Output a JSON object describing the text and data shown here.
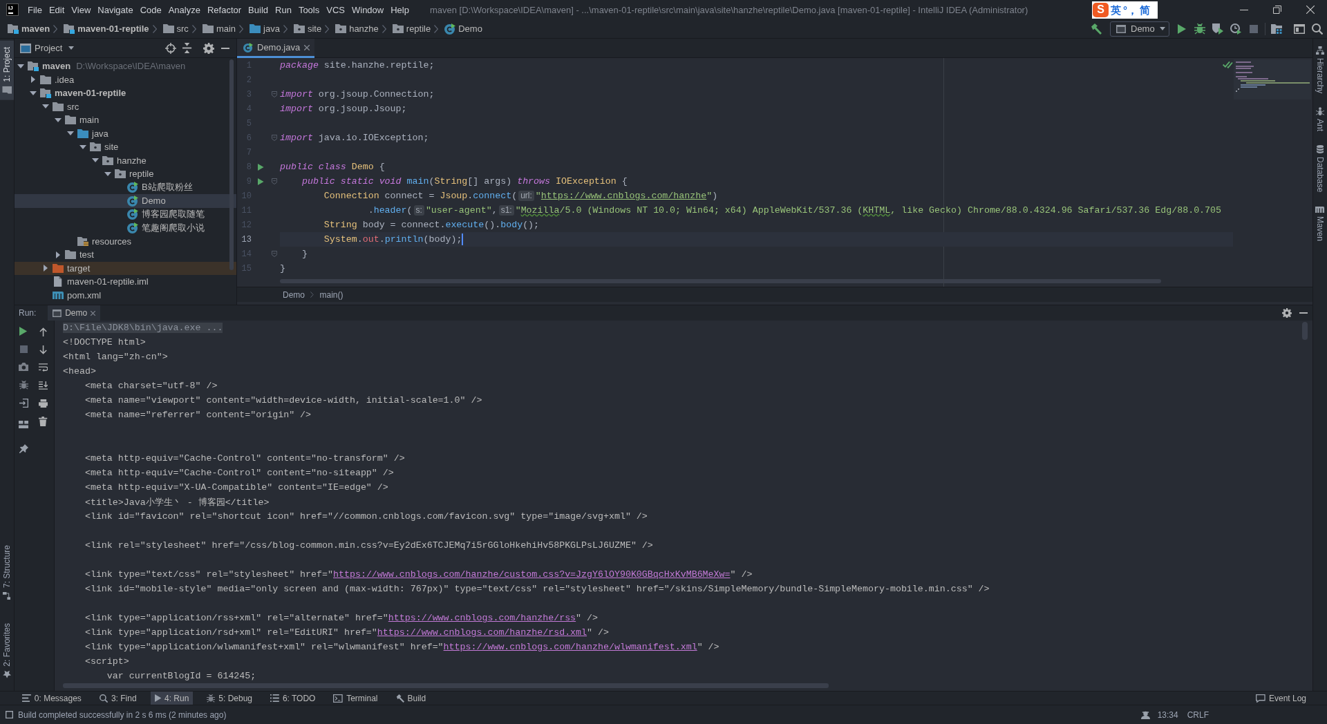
{
  "window": {
    "logo": "IJ",
    "title": "maven [D:\\Workspace\\IDEA\\maven] - ...\\maven-01-reptile\\src\\main\\java\\site\\hanzhe\\reptile\\Demo.java [maven-01-reptile] - IntelliJ IDEA (Administrator)"
  },
  "menu": [
    "File",
    "Edit",
    "View",
    "Navigate",
    "Code",
    "Analyze",
    "Refactor",
    "Build",
    "Run",
    "Tools",
    "VCS",
    "Window",
    "Help"
  ],
  "input_method_bar": {
    "logo": "S",
    "items": [
      "英",
      "°，",
      "简"
    ]
  },
  "navigation_bar": {
    "crumbs": [
      {
        "label": "maven",
        "kind": "module"
      },
      {
        "label": "maven-01-reptile",
        "kind": "module"
      },
      {
        "label": "src",
        "kind": "folder"
      },
      {
        "label": "main",
        "kind": "folder"
      },
      {
        "label": "java",
        "kind": "source"
      },
      {
        "label": "site",
        "kind": "package"
      },
      {
        "label": "hanzhe",
        "kind": "package"
      },
      {
        "label": "reptile",
        "kind": "package"
      },
      {
        "label": "Demo",
        "kind": "class"
      }
    ],
    "run_configuration": "Demo"
  },
  "left_stripe": {
    "top": [
      {
        "label": "1: Project",
        "kind": "project",
        "selected": true
      }
    ],
    "bottom": [
      {
        "label": "7: Structure",
        "kind": "structure",
        "selected": false
      },
      {
        "label": "2: Favorites",
        "kind": "favorites",
        "selected": false
      }
    ]
  },
  "right_stripe": [
    {
      "label": "Hierarchy",
      "kind": "hierarchy"
    },
    {
      "label": "Ant",
      "kind": "ant"
    },
    {
      "label": "Database",
      "kind": "database"
    },
    {
      "label": "Maven",
      "kind": "maven"
    }
  ],
  "project": {
    "view": "Project",
    "tree": [
      {
        "label": "maven",
        "kind": "module",
        "path": "D:\\Workspace\\IDEA\\maven",
        "expanded": true,
        "selected": false,
        "children": [
          {
            "label": ".idea",
            "kind": "folder",
            "expanded": false,
            "selected": false
          },
          {
            "label": "maven-01-reptile",
            "kind": "module",
            "expanded": true,
            "selected": false,
            "children": [
              {
                "label": "src",
                "kind": "folder",
                "expanded": true,
                "selected": false,
                "children": [
                  {
                    "label": "main",
                    "kind": "folder",
                    "expanded": true,
                    "selected": false,
                    "children": [
                      {
                        "label": "java",
                        "kind": "source",
                        "expanded": true,
                        "selected": false,
                        "children": [
                          {
                            "label": "site",
                            "kind": "package",
                            "expanded": true,
                            "selected": false,
                            "children": [
                              {
                                "label": "hanzhe",
                                "kind": "package",
                                "expanded": true,
                                "selected": false,
                                "children": [
                                  {
                                    "label": "reptile",
                                    "kind": "package",
                                    "expanded": true,
                                    "selected": false,
                                    "children": [
                                      {
                                        "label": "B站爬取粉丝",
                                        "kind": "class",
                                        "selected": false
                                      },
                                      {
                                        "label": "Demo",
                                        "kind": "class",
                                        "selected": true
                                      },
                                      {
                                        "label": "博客园爬取随笔",
                                        "kind": "class",
                                        "selected": false
                                      },
                                      {
                                        "label": "笔趣阁爬取小说",
                                        "kind": "class",
                                        "selected": false
                                      }
                                    ]
                                  }
                                ]
                              }
                            ]
                          }
                        ]
                      },
                      {
                        "label": "resources",
                        "kind": "resources",
                        "selected": false
                      }
                    ]
                  },
                  {
                    "label": "test",
                    "kind": "folder",
                    "expanded": false,
                    "selected": false
                  }
                ]
              },
              {
                "label": "target",
                "kind": "excluded",
                "expanded": false,
                "selected": false
              },
              {
                "label": "maven-01-reptile.iml",
                "kind": "iml",
                "selected": false
              },
              {
                "label": "pom.xml",
                "kind": "maven",
                "selected": false
              }
            ]
          }
        ]
      }
    ]
  },
  "editor": {
    "tabs": [
      {
        "label": "Demo.java",
        "selected": true
      }
    ],
    "lines": [
      {
        "number": "1",
        "current": false,
        "run_marker": false,
        "fold": false,
        "tokens": [
          {
            "text": "package",
            "kind": "keyword"
          },
          {
            "text": " site.hanzhe.reptile;",
            "kind": "plain"
          }
        ]
      },
      {
        "number": "2",
        "current": false,
        "run_marker": false,
        "fold": false
      },
      {
        "number": "3",
        "current": false,
        "run_marker": false,
        "fold": true,
        "tokens": [
          {
            "text": "import",
            "kind": "keyword"
          },
          {
            "text": " org.jsoup.Connection;",
            "kind": "plain"
          }
        ]
      },
      {
        "number": "4",
        "current": false,
        "run_marker": false,
        "fold": false,
        "tokens": [
          {
            "text": "import",
            "kind": "keyword"
          },
          {
            "text": " org.jsoup.Jsoup;",
            "kind": "plain"
          }
        ]
      },
      {
        "number": "5",
        "current": false,
        "run_marker": false,
        "fold": false
      },
      {
        "number": "6",
        "current": false,
        "run_marker": false,
        "fold": true,
        "tokens": [
          {
            "text": "import",
            "kind": "keyword"
          },
          {
            "text": " java.io.IOException;",
            "kind": "plain"
          }
        ]
      },
      {
        "number": "7",
        "current": false,
        "run_marker": false,
        "fold": false
      },
      {
        "number": "8",
        "current": false,
        "run_marker": true,
        "fold": false,
        "tokens": [
          {
            "text": "public class ",
            "kind": "keyword"
          },
          {
            "text": "Demo",
            "kind": "type"
          },
          {
            "text": " {",
            "kind": "plain"
          }
        ]
      },
      {
        "number": "9",
        "current": false,
        "run_marker": true,
        "fold": true,
        "tokens": [
          {
            "text": "    public static void ",
            "kind": "keyword"
          },
          {
            "text": "main",
            "kind": "method"
          },
          {
            "text": "(",
            "kind": "plain"
          },
          {
            "text": "String",
            "kind": "type"
          },
          {
            "text": "[] args) ",
            "kind": "plain"
          },
          {
            "text": "throws ",
            "kind": "keyword"
          },
          {
            "text": "IOException",
            "kind": "type"
          },
          {
            "text": " {",
            "kind": "plain"
          }
        ]
      },
      {
        "number": "10",
        "current": false,
        "run_marker": false,
        "fold": false,
        "tokens": [
          {
            "text": "        Connection",
            "kind": "type"
          },
          {
            "text": " connect = ",
            "kind": "plain"
          },
          {
            "text": "Jsoup",
            "kind": "type"
          },
          {
            "text": ".",
            "kind": "plain"
          },
          {
            "text": "connect",
            "kind": "method"
          },
          {
            "text": "(",
            "kind": "plain"
          },
          {
            "text": "url:",
            "kind": "hint"
          },
          {
            "text": "\"",
            "kind": "string"
          },
          {
            "text": "https://www.cnblogs.com/hanzhe",
            "kind": "url"
          },
          {
            "text": "\"",
            "kind": "string"
          },
          {
            "text": ")",
            "kind": "plain"
          }
        ]
      },
      {
        "number": "11",
        "current": false,
        "run_marker": false,
        "fold": false,
        "tokens": [
          {
            "text": "                .",
            "kind": "plain"
          },
          {
            "text": "header",
            "kind": "method"
          },
          {
            "text": "(",
            "kind": "plain"
          },
          {
            "text": "s:",
            "kind": "hint"
          },
          {
            "text": "\"user-agent\"",
            "kind": "string"
          },
          {
            "text": ",",
            "kind": "plain"
          },
          {
            "text": "s1:",
            "kind": "hint"
          },
          {
            "text": "\"",
            "kind": "string"
          },
          {
            "text": "Mozilla",
            "kind": "typo"
          },
          {
            "text": "/5.0 (Windows NT 10.0; Win64; x64) AppleWebKit/537.36 (",
            "kind": "string"
          },
          {
            "text": "KHTML",
            "kind": "typo"
          },
          {
            "text": ", like Gecko) Chrome/88.0.4324.96 Safari/537.36 Edg/88.0.705",
            "kind": "string"
          }
        ]
      },
      {
        "number": "12",
        "current": false,
        "run_marker": false,
        "fold": false,
        "tokens": [
          {
            "text": "        String",
            "kind": "type"
          },
          {
            "text": " body = connect.",
            "kind": "plain"
          },
          {
            "text": "execute",
            "kind": "method"
          },
          {
            "text": "().",
            "kind": "plain"
          },
          {
            "text": "body",
            "kind": "method"
          },
          {
            "text": "();",
            "kind": "plain"
          }
        ]
      },
      {
        "number": "13",
        "current": true,
        "run_marker": false,
        "fold": false,
        "tokens": [
          {
            "text": "        System",
            "kind": "type"
          },
          {
            "text": ".",
            "kind": "plain"
          },
          {
            "text": "out",
            "kind": "field"
          },
          {
            "text": ".",
            "kind": "plain"
          },
          {
            "text": "println",
            "kind": "method"
          },
          {
            "text": "(body);",
            "kind": "plain"
          }
        ]
      },
      {
        "number": "14",
        "current": false,
        "run_marker": false,
        "fold": true,
        "tokens": [
          {
            "text": "    }",
            "kind": "plain"
          }
        ]
      },
      {
        "number": "15",
        "current": false,
        "run_marker": false,
        "fold": false,
        "tokens": [
          {
            "text": "}",
            "kind": "plain"
          }
        ]
      }
    ],
    "breadcrumbs": [
      "Demo",
      "main()"
    ]
  },
  "run": {
    "label": "Run:",
    "tabs": [
      {
        "label": "Demo",
        "selected": true
      }
    ],
    "console": [
      {
        "kind": "command",
        "parts": [
          {
            "text": "D:\\File\\JDK8\\bin\\java.exe ...",
            "kind": "text"
          }
        ]
      },
      {
        "kind": "output",
        "parts": [
          {
            "text": "<!DOCTYPE html>",
            "kind": "text"
          }
        ]
      },
      {
        "kind": "output",
        "parts": [
          {
            "text": "<html lang=\"zh-cn\">",
            "kind": "text"
          }
        ]
      },
      {
        "kind": "output",
        "parts": [
          {
            "text": "<head>",
            "kind": "text"
          }
        ]
      },
      {
        "kind": "output",
        "parts": [
          {
            "text": "    <meta charset=\"utf-8\" />",
            "kind": "text"
          }
        ]
      },
      {
        "kind": "output",
        "parts": [
          {
            "text": "    <meta name=\"viewport\" content=\"width=device-width, initial-scale=1.0\" />",
            "kind": "text"
          }
        ]
      },
      {
        "kind": "output",
        "parts": [
          {
            "text": "    <meta name=\"referrer\" content=\"origin\" />",
            "kind": "text"
          }
        ]
      },
      {
        "kind": "blank"
      },
      {
        "kind": "blank"
      },
      {
        "kind": "output",
        "parts": [
          {
            "text": "    <meta http-equiv=\"Cache-Control\" content=\"no-transform\" />",
            "kind": "text"
          }
        ]
      },
      {
        "kind": "output",
        "parts": [
          {
            "text": "    <meta http-equiv=\"Cache-Control\" content=\"no-siteapp\" />",
            "kind": "text"
          }
        ]
      },
      {
        "kind": "output",
        "parts": [
          {
            "text": "    <meta http-equiv=\"X-UA-Compatible\" content=\"IE=edge\" />",
            "kind": "text"
          }
        ]
      },
      {
        "kind": "output",
        "parts": [
          {
            "text": "    <title>Java小学生丶 - 博客园</title>",
            "kind": "text"
          }
        ]
      },
      {
        "kind": "output",
        "parts": [
          {
            "text": "    <link id=\"favicon\" rel=\"shortcut icon\" href=\"//common.cnblogs.com/favicon.svg\" type=\"image/svg+xml\" />",
            "kind": "text"
          }
        ]
      },
      {
        "kind": "blank"
      },
      {
        "kind": "output",
        "parts": [
          {
            "text": "    <link rel=\"stylesheet\" href=\"/css/blog-common.min.css?v=Ey2dEx6TCJEMq7i5rGGloHkehiHv58PKGLPsLJ6UZME\" />",
            "kind": "text"
          }
        ]
      },
      {
        "kind": "blank"
      },
      {
        "kind": "output",
        "parts": [
          {
            "text": "    <link type=\"text/css\" rel=\"stylesheet\" href=\"",
            "kind": "text"
          },
          {
            "text": "https://www.cnblogs.com/hanzhe/custom.css?v=JzgY6lOY90K0GBqcHxKvMB6MeXw=",
            "kind": "link"
          },
          {
            "text": "\" />",
            "kind": "text"
          }
        ]
      },
      {
        "kind": "output",
        "parts": [
          {
            "text": "    <link id=\"mobile-style\" media=\"only screen and (max-width: 767px)\" type=\"text/css\" rel=\"stylesheet\" href=\"/skins/SimpleMemory/bundle-SimpleMemory-mobile.min.css\" />",
            "kind": "text"
          }
        ]
      },
      {
        "kind": "blank"
      },
      {
        "kind": "output",
        "parts": [
          {
            "text": "    <link type=\"application/rss+xml\" rel=\"alternate\" href=\"",
            "kind": "text"
          },
          {
            "text": "https://www.cnblogs.com/hanzhe/rss",
            "kind": "link"
          },
          {
            "text": "\" />",
            "kind": "text"
          }
        ]
      },
      {
        "kind": "output",
        "parts": [
          {
            "text": "    <link type=\"application/rsd+xml\" rel=\"EditURI\" href=\"",
            "kind": "text"
          },
          {
            "text": "https://www.cnblogs.com/hanzhe/rsd.xml",
            "kind": "link"
          },
          {
            "text": "\" />",
            "kind": "text"
          }
        ]
      },
      {
        "kind": "output",
        "parts": [
          {
            "text": "    <link type=\"application/wlwmanifest+xml\" rel=\"wlwmanifest\" href=\"",
            "kind": "text"
          },
          {
            "text": "https://www.cnblogs.com/hanzhe/wlwmanifest.xml",
            "kind": "link"
          },
          {
            "text": "\" />",
            "kind": "text"
          }
        ]
      },
      {
        "kind": "output",
        "parts": [
          {
            "text": "    <script>",
            "kind": "text"
          }
        ]
      },
      {
        "kind": "output",
        "parts": [
          {
            "text": "        var currentBlogId = 614245;",
            "kind": "text"
          }
        ]
      }
    ]
  },
  "tool_windows": [
    {
      "label": "0: Messages",
      "kind": "messages",
      "selected": false
    },
    {
      "label": "3: Find",
      "kind": "find",
      "selected": false
    },
    {
      "label": "4: Run",
      "kind": "run",
      "selected": true
    },
    {
      "label": "5: Debug",
      "kind": "debug",
      "selected": false
    },
    {
      "label": "6: TODO",
      "kind": "todo",
      "selected": false
    },
    {
      "label": "Terminal",
      "kind": "terminal",
      "selected": false
    },
    {
      "label": "Build",
      "kind": "build",
      "selected": false
    }
  ],
  "event_log": "Event Log",
  "status_bar": {
    "message": "Build completed successfully in 2 s 6 ms (2 minutes ago)",
    "caret_position": "13:34",
    "line_separator": "CRLF"
  }
}
